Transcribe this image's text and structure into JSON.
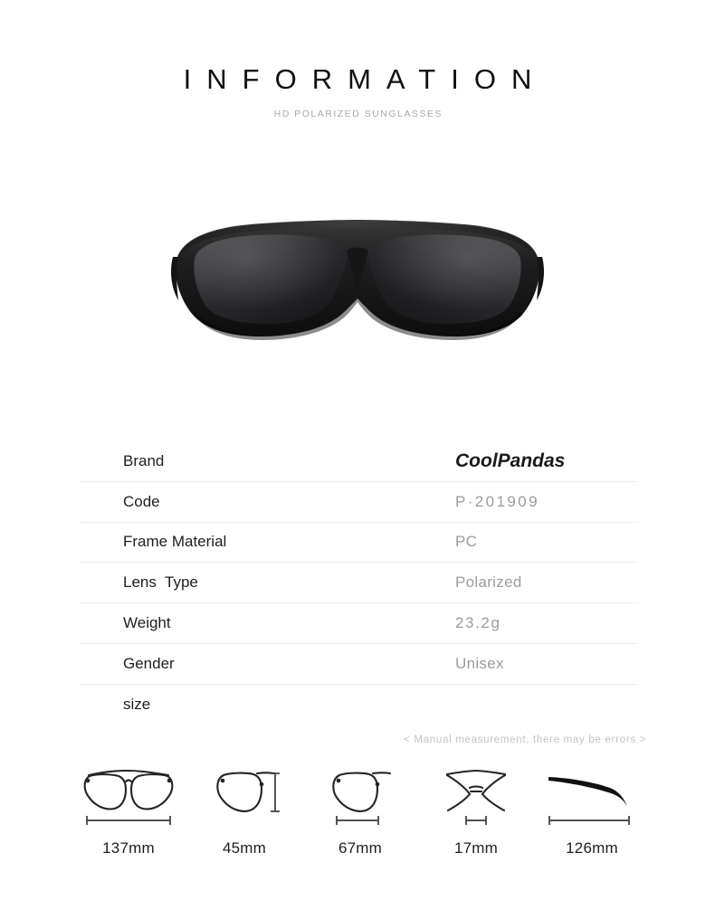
{
  "header": {
    "title": "INFORMATION",
    "subtitle": "HD POLARIZED SUNGLASSES"
  },
  "product": {
    "image_name": "wraparound-polarized-sunglasses-front-view",
    "frame_color": "#1a1a1a",
    "lens_color": "#2b2b2d"
  },
  "spec_table": {
    "rows": [
      {
        "label": "Brand",
        "value": "CoolPandas"
      },
      {
        "label": "Code",
        "value": "P·201909"
      },
      {
        "label": "Frame Material",
        "value": "PC"
      },
      {
        "label": "Lens  Type",
        "value": "Polarized"
      },
      {
        "label": "Weight",
        "value": "23.2g"
      },
      {
        "label": "Gender",
        "value": "Unisex"
      },
      {
        "label": "size",
        "value": ""
      }
    ]
  },
  "disclaimer": "< Manual measurement, there may be errors >",
  "measurements": [
    {
      "icon": "full-frame-front-icon",
      "value": "137mm"
    },
    {
      "icon": "lens-height-icon",
      "value": "45mm"
    },
    {
      "icon": "lens-width-icon",
      "value": "67mm"
    },
    {
      "icon": "nose-bridge-icon",
      "value": "17mm"
    },
    {
      "icon": "temple-arm-icon",
      "value": "126mm"
    }
  ],
  "colors": {
    "text_primary": "#1d1d1d",
    "text_muted": "#9b9b9b",
    "divider": "#ececec",
    "subtitle": "#a8a8a8",
    "disclaimer": "#c3c3c3",
    "background": "#ffffff"
  }
}
